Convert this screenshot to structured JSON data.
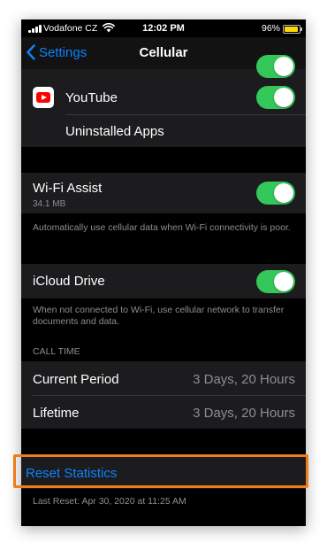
{
  "status_bar": {
    "carrier": "Vodafone CZ",
    "time": "12:02 PM",
    "battery": "96%",
    "battery_color": "#ffd60a",
    "icons": [
      "signal-icon",
      "wifi-icon",
      "battery-icon"
    ]
  },
  "nav": {
    "back_label": "Settings",
    "title": "Cellular"
  },
  "apps": [
    {
      "label": "YouTube",
      "toggle_on": true,
      "icon": "youtube-icon"
    },
    {
      "label": "Uninstalled Apps"
    }
  ],
  "wifi_assist": {
    "label": "Wi-Fi Assist",
    "usage": "34.1 MB",
    "toggle_on": true,
    "footnote": "Automatically use cellular data when Wi-Fi connectivity is poor."
  },
  "icloud": {
    "label": "iCloud Drive",
    "toggle_on": true,
    "footnote": "When not connected to Wi-Fi, use cellular network to transfer documents and data."
  },
  "call_time": {
    "header": "CALL TIME",
    "rows": [
      {
        "label": "Current Period",
        "value": "3 Days, 20 Hours"
      },
      {
        "label": "Lifetime",
        "value": "3 Days, 20 Hours"
      }
    ]
  },
  "reset": {
    "label": "Reset Statistics",
    "last_reset": "Last Reset: Apr 30, 2020 at 11:25 AM"
  },
  "colors": {
    "accent": "#0a84ff",
    "toggle_on": "#34c759",
    "highlight": "#f07c1b"
  }
}
